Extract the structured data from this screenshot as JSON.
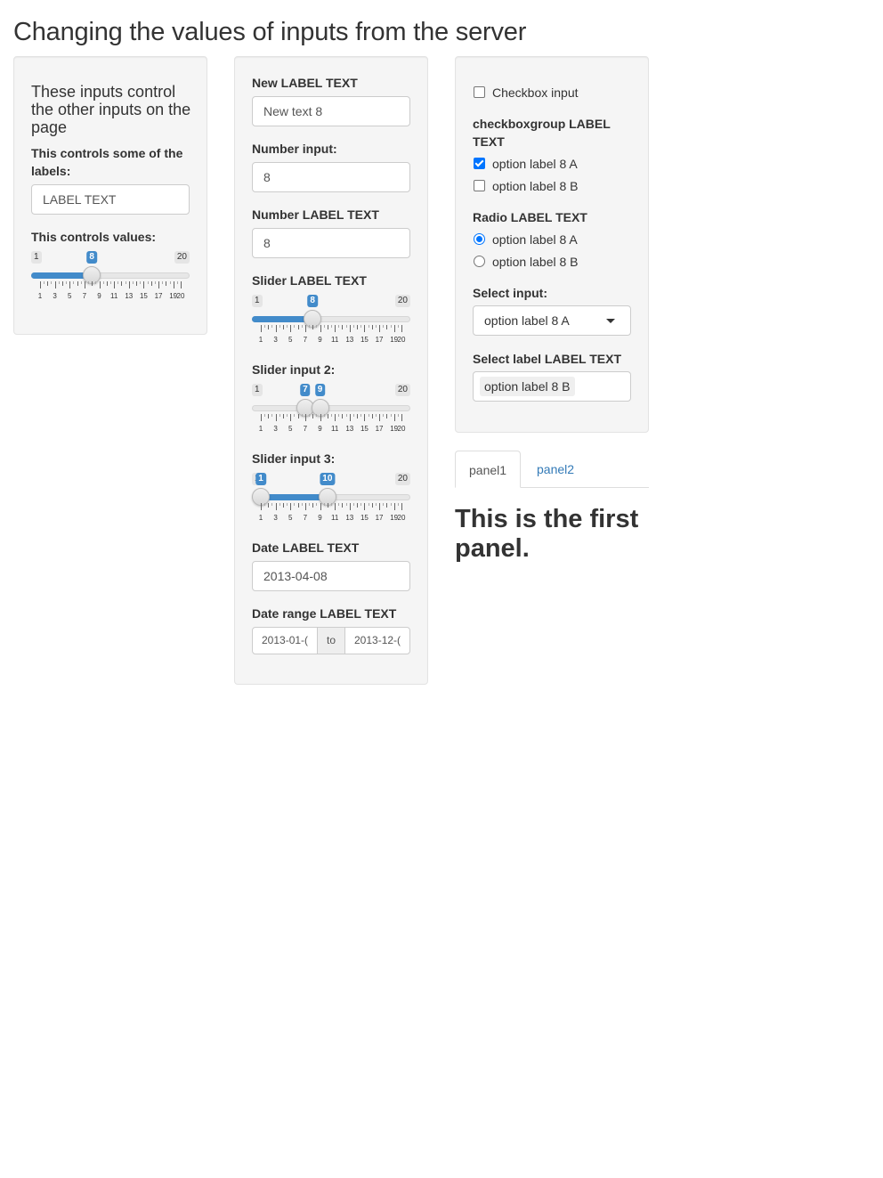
{
  "page": {
    "title": "Changing the values of inputs from the server"
  },
  "control_panel": {
    "heading": "These inputs control the other inputs on the page",
    "label_control": {
      "label": "This controls some of the labels:",
      "value": "LABEL TEXT"
    },
    "value_control": {
      "label": "This controls values:",
      "min": "1",
      "max": "20",
      "value": "8",
      "ticks": [
        "1",
        "3",
        "5",
        "7",
        "9",
        "11",
        "13",
        "15",
        "17",
        "19",
        "20"
      ]
    }
  },
  "inputs_panel": {
    "text_input": {
      "label": "New LABEL TEXT",
      "value": "New text 8"
    },
    "number_input": {
      "label": "Number input:",
      "value": "8"
    },
    "number_label_input": {
      "label": "Number LABEL TEXT",
      "value": "8"
    },
    "slider1": {
      "label": "Slider LABEL TEXT",
      "min": "1",
      "max": "20",
      "value": "8"
    },
    "slider2": {
      "label": "Slider input 2:",
      "min": "1",
      "max": "20",
      "from": "7",
      "to": "9"
    },
    "slider3": {
      "label": "Slider input 3:",
      "min": "1",
      "max": "20",
      "from": "1",
      "to": "10"
    },
    "slider_ticks": [
      "1",
      "3",
      "5",
      "7",
      "9",
      "11",
      "13",
      "15",
      "17",
      "19",
      "20"
    ],
    "date_input": {
      "label": "Date LABEL TEXT",
      "value": "2013-04-08"
    },
    "date_range": {
      "label": "Date range LABEL TEXT",
      "start": "2013-01-(",
      "separator": "to",
      "end": "2013-12-("
    }
  },
  "choices_panel": {
    "checkbox": {
      "label": "Checkbox input",
      "checked": false
    },
    "checkbox_group": {
      "label": "checkboxgroup LABEL TEXT",
      "options": [
        {
          "label": "option label 8 A",
          "checked": true
        },
        {
          "label": "option label 8 B",
          "checked": false
        }
      ]
    },
    "radio_group": {
      "label": "Radio LABEL TEXT",
      "options": [
        {
          "label": "option label 8 A",
          "checked": true
        },
        {
          "label": "option label 8 B",
          "checked": false
        }
      ]
    },
    "select_input": {
      "label": "Select input:",
      "value": "option label 8 A"
    },
    "select_label": {
      "label": "Select label LABEL TEXT",
      "value": "option label 8 B"
    }
  },
  "tabs": {
    "items": [
      {
        "label": "panel1",
        "active": true
      },
      {
        "label": "panel2",
        "active": false
      }
    ],
    "content": "This is the first panel."
  },
  "colors": {
    "accent": "#428bca",
    "link": "#337ab7",
    "check": "#0075ff"
  }
}
